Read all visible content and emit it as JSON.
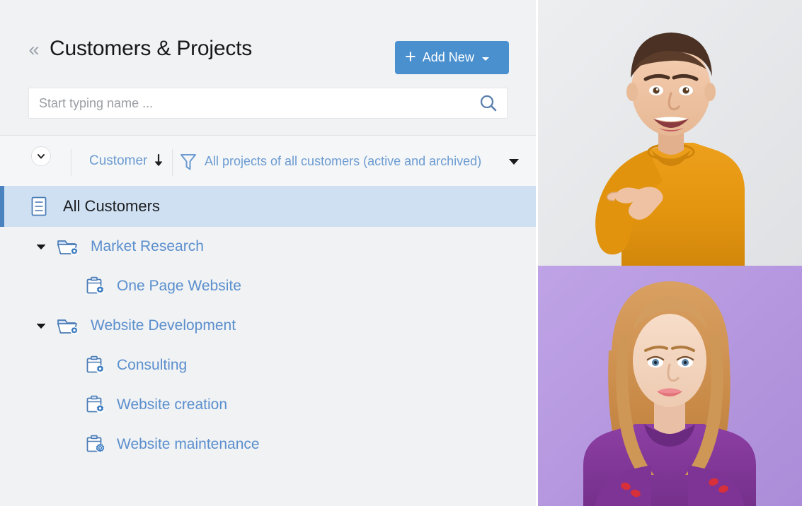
{
  "header": {
    "collapse_icon": "chevrons-left-icon",
    "title": "Customers & Projects",
    "add_button": {
      "plus": "+",
      "label": "Add New",
      "caret_icon": "caret-down-icon"
    }
  },
  "search": {
    "placeholder": "Start typing name ...",
    "value": "",
    "icon": "search-icon"
  },
  "filter_bar": {
    "expand_toggle_icon": "chevron-down-icon",
    "sort_label": "Customer",
    "sort_direction_icon": "arrow-down-icon",
    "funnel_icon": "funnel-icon",
    "filter_text": "All projects of all customers (active and archived)",
    "dropdown_caret_icon": "caret-down-icon"
  },
  "tree": {
    "rows": [
      {
        "label": "All Customers",
        "level": "all",
        "icon": "list-document-icon",
        "selected": true,
        "expandable": false
      },
      {
        "label": "Market Research",
        "level": "customer",
        "icon": "folder-gear-icon",
        "selected": false,
        "expandable": true,
        "expanded": true
      },
      {
        "label": "One Page Website",
        "level": "project",
        "icon": "project-board-gear-icon",
        "selected": false,
        "expandable": false
      },
      {
        "label": "Website Development",
        "level": "customer",
        "icon": "folder-gear-icon",
        "selected": false,
        "expandable": true,
        "expanded": true
      },
      {
        "label": "Consulting",
        "level": "project",
        "icon": "project-board-gear-icon",
        "selected": false,
        "expandable": false
      },
      {
        "label": "Website creation",
        "level": "project",
        "icon": "project-board-gear-icon",
        "selected": false,
        "expandable": false
      },
      {
        "label": "Website maintenance",
        "level": "project",
        "icon": "project-board-gear-icon",
        "selected": false,
        "expandable": false
      }
    ]
  },
  "photos": [
    {
      "name": "photo-man-orange-sweater-pointing",
      "background": "#e7e8ea",
      "subject": "smiling young man in orange sweater pointing left with thumb"
    },
    {
      "name": "photo-woman-purple-sweater",
      "background": "#b79ae0",
      "subject": "young woman with long auburn hair in purple sweater, arms crossed"
    }
  ],
  "colors": {
    "accent_blue": "#4a90cf",
    "link_blue": "#5b8fcd",
    "selected_row_bg": "#cfe0f2",
    "selected_row_bar": "#4b83c0",
    "panel_bg": "#f0f2f4",
    "filter_bar_bg": "#f4f6f7"
  }
}
